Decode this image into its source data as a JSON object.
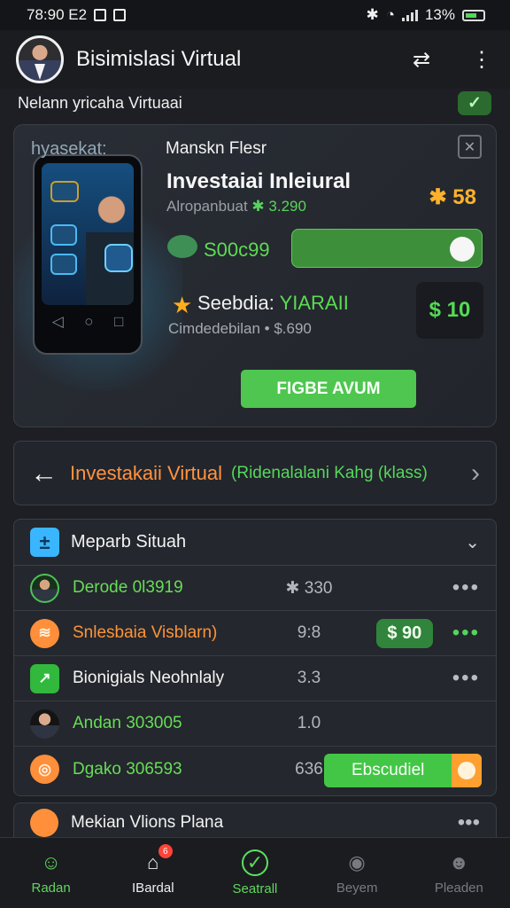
{
  "status_bar": {
    "time": "78:90 E2",
    "battery": "13%"
  },
  "header": {
    "title": "Bisimislasi Virtual"
  },
  "subheader": {
    "text": "Nelann yricaha Virtuaai"
  },
  "promo": {
    "brand": "hyasekat:",
    "brand_tag": "Manskn Flesr",
    "heading": "Investaiai Inleiural",
    "stat": "✱ 58",
    "small_prefix": "Alropanbuat",
    "small_value": "✱ 3.290",
    "value_label": "S00c99",
    "line_label": "Seebdia:",
    "line_value": "YIARAII",
    "caption": "Cimdedebilan • $.690",
    "price": "$ 10",
    "cta": "FIGBE AVUM"
  },
  "breadcrumb": {
    "title": "Investakaii Virtual",
    "subtitle": "(Ridenalalani Kahg (klass)"
  },
  "list": {
    "title": "Meparb Situah",
    "rows": [
      {
        "label": "Derode 0l3919",
        "value": "✱ 330",
        "menu": "•••"
      },
      {
        "label": "Snlesbaia Visblarn)",
        "value": "9:8",
        "chip": "$ 90",
        "menu": "•••"
      },
      {
        "label": "Bionigials Neohnlaly",
        "value": "3.3",
        "menu": "•••"
      },
      {
        "label": "Andan 303005",
        "value": "1.0"
      },
      {
        "label": "Dgako 306593",
        "value": "636",
        "action": "Ebscudiel"
      }
    ]
  },
  "teaser": {
    "title": "Mekian Vlions Plana",
    "menu": "•••"
  },
  "bottom_nav": [
    {
      "label": "Radan",
      "badge": ""
    },
    {
      "label": "IBardal",
      "badge": "6"
    },
    {
      "label": "Seatrall",
      "badge": ""
    },
    {
      "label": "Beyem",
      "badge": ""
    },
    {
      "label": "Pleaden",
      "badge": ""
    }
  ]
}
